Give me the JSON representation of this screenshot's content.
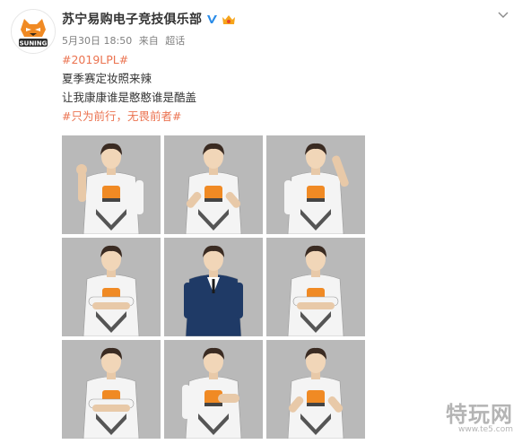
{
  "post": {
    "avatar_logo_text": "SUNING",
    "username": "苏宁易购电子竞技俱乐部",
    "verified_icon": "blue-v-verified-icon",
    "member_icon": "vip-member-icon",
    "meta": {
      "date": "5月30日 18:50",
      "source_prefix": "来自",
      "source": "超话"
    },
    "text_lines": [
      {
        "text": "#2019LPL#",
        "hashtag": true
      },
      {
        "text": "夏季赛定妆照来辣",
        "hashtag": false
      },
      {
        "text": "让我康康谁是憨憨谁是酷盖",
        "hashtag": false
      },
      {
        "text": "#只为前行，无畏前者#",
        "hashtag": true
      }
    ],
    "photos": [
      {
        "pose": "fist",
        "outfit": "jersey"
      },
      {
        "pose": "point",
        "outfit": "jersey"
      },
      {
        "pose": "hand-head",
        "outfit": "jersey"
      },
      {
        "pose": "crossed",
        "outfit": "jersey"
      },
      {
        "pose": "suit",
        "outfit": "suit"
      },
      {
        "pose": "crossed",
        "outfit": "jersey"
      },
      {
        "pose": "crossed",
        "outfit": "jersey"
      },
      {
        "pose": "thumb",
        "outfit": "jersey"
      },
      {
        "pose": "point-chest",
        "outfit": "jersey"
      }
    ],
    "colors": {
      "hashtag": "#eb7350",
      "photo_bg": "#b9b9b9",
      "jersey": "#f4f4f4",
      "accent": "#f08a24",
      "suit": "#1f3a66"
    }
  },
  "watermark": {
    "main": "特玩网",
    "url": "www.te5.com"
  }
}
